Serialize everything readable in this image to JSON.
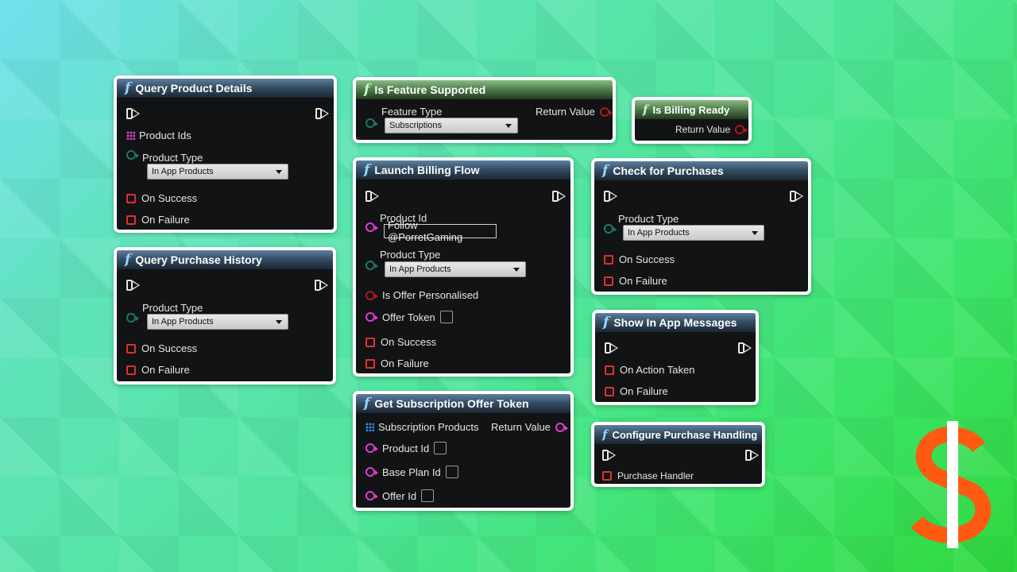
{
  "colors": {
    "accent_pin_magenta": "#e23ad6",
    "pin_teal": "#1a7a6a",
    "delegate_red": "#e03030",
    "dollar_orange": "#ff5a12"
  },
  "icons": [
    "function-icon",
    "exec-pin-icon",
    "delegate-pin-icon",
    "array-pin-icon",
    "dollar-logo-icon"
  ],
  "nodes": {
    "query_product_details": {
      "title": "Query Product Details",
      "product_ids": "Product Ids",
      "product_type_label": "Product Type",
      "product_type_value": "In App Products",
      "on_success": "On Success",
      "on_failure": "On Failure"
    },
    "query_purchase_history": {
      "title": "Query Purchase History",
      "product_type_label": "Product Type",
      "product_type_value": "In App Products",
      "on_success": "On Success",
      "on_failure": "On Failure"
    },
    "is_feature_supported": {
      "title": "Is Feature Supported",
      "feature_type_label": "Feature Type",
      "feature_type_value": "Subscriptions",
      "return_value": "Return Value"
    },
    "is_billing_ready": {
      "title": "Is Billing Ready",
      "return_value": "Return Value"
    },
    "launch_billing_flow": {
      "title": "Launch Billing Flow",
      "product_id_label": "Product Id",
      "product_id_value": "Follow @PorretGaming",
      "product_type_label": "Product Type",
      "product_type_value": "In App Products",
      "is_offer_personalised": "Is Offer Personalised",
      "offer_token": "Offer Token",
      "on_success": "On Success",
      "on_failure": "On Failure"
    },
    "check_for_purchases": {
      "title": "Check for Purchases",
      "product_type_label": "Product Type",
      "product_type_value": "In App Products",
      "on_success": "On Success",
      "on_failure": "On Failure"
    },
    "show_in_app_messages": {
      "title": "Show In App Messages",
      "on_action_taken": "On Action Taken",
      "on_failure": "On Failure"
    },
    "get_subscription_offer_token": {
      "title": "Get Subscription Offer Token",
      "subscription_products": "Subscription Products",
      "return_value": "Return Value",
      "product_id": "Product Id",
      "base_plan_id": "Base Plan Id",
      "offer_id": "Offer Id"
    },
    "configure_purchase_handling": {
      "title": "Configure Purchase Handling",
      "purchase_handler": "Purchase Handler"
    }
  }
}
